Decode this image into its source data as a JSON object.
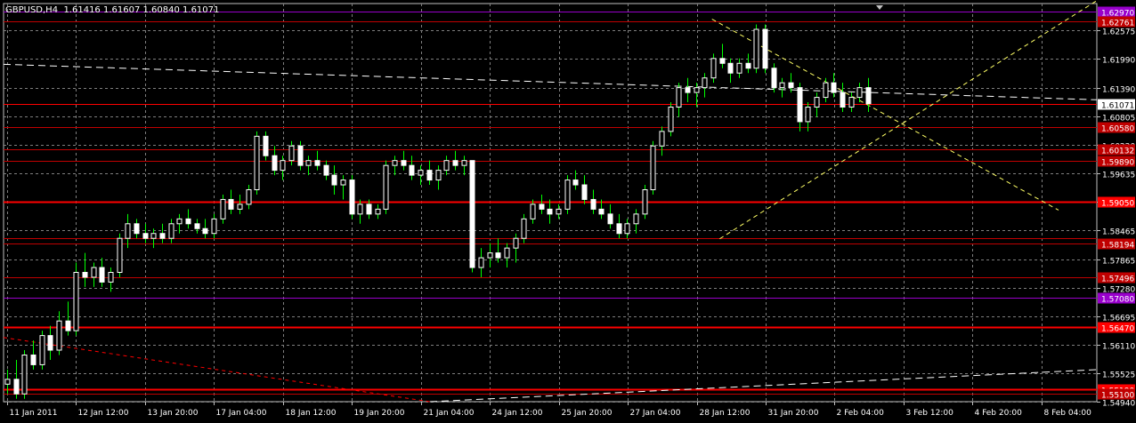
{
  "window": {
    "symbol_tf": "GBPUSD,H4",
    "ohlc": "1.61416 1.61607 1.60840 1.61071"
  },
  "colors": {
    "background": "#000000",
    "grid": "#7f7f7f",
    "candle": "#ffffff",
    "wick": "#00ff00",
    "level_red": "#ff0000",
    "level_dark_red": "#c00000",
    "level_purple": "#9900cc",
    "trend_yellow": "#ffff66",
    "trend_white": "#ffffff",
    "trend_red": "#ff0000",
    "axis_text": "#ffffff"
  },
  "chart_data": {
    "type": "candlestick",
    "title": "GBPUSD,H4",
    "ylim": [
      1.5494,
      1.6313
    ],
    "y_ticks": [
      "1.62575",
      "1.61990",
      "1.61390",
      "1.60805",
      "1.60220",
      "1.59635",
      "1.59050",
      "1.58465",
      "1.57865",
      "1.57280",
      "1.56695",
      "1.56110",
      "1.55525",
      "1.54940"
    ],
    "x_ticks": [
      "11 Jan 2011",
      "12 Jan 12:00",
      "13 Jan 20:00",
      "17 Jan 04:00",
      "18 Jan 12:00",
      "19 Jan 20:00",
      "21 Jan 04:00",
      "24 Jan 12:00",
      "25 Jan 20:00",
      "27 Jan 04:00",
      "28 Jan 12:00",
      "31 Jan 20:00",
      "2 Feb 04:00",
      "3 Feb 12:00",
      "4 Feb 20:00",
      "8 Feb 04:00"
    ],
    "current_price": "1.61071",
    "levels": [
      {
        "price": 1.6297,
        "label": "1.62970",
        "style": "purple"
      },
      {
        "price": 1.62761,
        "label": "1.62761",
        "style": "dark_red"
      },
      {
        "price": 1.61071,
        "label": "1.61071",
        "style": "current"
      },
      {
        "price": 1.6058,
        "label": "1.60580",
        "style": "dark_red"
      },
      {
        "price": 1.60132,
        "label": "1.60132",
        "style": "dark_red"
      },
      {
        "price": 1.5989,
        "label": "1.59890",
        "style": "dark_red"
      },
      {
        "price": 1.5905,
        "label": "1.59050",
        "style": "red"
      },
      {
        "price": 1.583,
        "label": "",
        "style": "dark_red"
      },
      {
        "price": 1.58194,
        "label": "1.58194",
        "style": "dark_red"
      },
      {
        "price": 1.57496,
        "label": "1.57496",
        "style": "dark_red"
      },
      {
        "price": 1.5708,
        "label": "1.57080",
        "style": "purple"
      },
      {
        "price": 1.5647,
        "label": "1.56470",
        "style": "red"
      },
      {
        "price": 1.5519,
        "label": "1.55190",
        "style": "red"
      },
      {
        "price": 1.551,
        "label": "1.55100",
        "style": "dark_red"
      }
    ],
    "candles": [
      [
        1.553,
        1.556,
        1.551,
        1.554
      ],
      [
        1.554,
        1.558,
        1.55,
        1.551
      ],
      [
        1.551,
        1.56,
        1.55,
        1.559
      ],
      [
        1.559,
        1.562,
        1.556,
        1.557
      ],
      [
        1.557,
        1.564,
        1.556,
        1.563
      ],
      [
        1.563,
        1.565,
        1.558,
        1.56
      ],
      [
        1.56,
        1.568,
        1.559,
        1.566
      ],
      [
        1.566,
        1.57,
        1.563,
        1.564
      ],
      [
        1.564,
        1.578,
        1.563,
        1.576
      ],
      [
        1.576,
        1.58,
        1.573,
        1.575
      ],
      [
        1.575,
        1.578,
        1.573,
        1.577
      ],
      [
        1.577,
        1.579,
        1.573,
        1.574
      ],
      [
        1.574,
        1.577,
        1.572,
        1.576
      ],
      [
        1.576,
        1.584,
        1.575,
        1.583
      ],
      [
        1.583,
        1.588,
        1.581,
        1.586
      ],
      [
        1.586,
        1.587,
        1.583,
        1.584
      ],
      [
        1.584,
        1.586,
        1.582,
        1.583
      ],
      [
        1.583,
        1.585,
        1.581,
        1.584
      ],
      [
        1.584,
        1.586,
        1.582,
        1.583
      ],
      [
        1.583,
        1.587,
        1.582,
        1.586
      ],
      [
        1.586,
        1.588,
        1.584,
        1.587
      ],
      [
        1.587,
        1.589,
        1.585,
        1.586
      ],
      [
        1.586,
        1.587,
        1.584,
        1.585
      ],
      [
        1.585,
        1.587,
        1.583,
        1.584
      ],
      [
        1.584,
        1.588,
        1.583,
        1.587
      ],
      [
        1.587,
        1.592,
        1.586,
        1.591
      ],
      [
        1.591,
        1.593,
        1.588,
        1.589
      ],
      [
        1.589,
        1.592,
        1.588,
        1.59
      ],
      [
        1.59,
        1.594,
        1.589,
        1.593
      ],
      [
        1.593,
        1.605,
        1.592,
        1.604
      ],
      [
        1.604,
        1.605,
        1.599,
        1.6
      ],
      [
        1.6,
        1.602,
        1.596,
        1.597
      ],
      [
        1.597,
        1.6,
        1.595,
        1.599
      ],
      [
        1.599,
        1.603,
        1.598,
        1.602
      ],
      [
        1.602,
        1.603,
        1.597,
        1.598
      ],
      [
        1.598,
        1.6,
        1.596,
        1.599
      ],
      [
        1.599,
        1.601,
        1.597,
        1.598
      ],
      [
        1.598,
        1.599,
        1.595,
        1.596
      ],
      [
        1.596,
        1.598,
        1.592,
        1.594
      ],
      [
        1.594,
        1.596,
        1.591,
        1.595
      ],
      [
        1.595,
        1.596,
        1.587,
        1.588
      ],
      [
        1.588,
        1.591,
        1.586,
        1.59
      ],
      [
        1.59,
        1.591,
        1.587,
        1.588
      ],
      [
        1.588,
        1.59,
        1.587,
        1.589
      ],
      [
        1.589,
        1.599,
        1.588,
        1.598
      ],
      [
        1.598,
        1.6,
        1.596,
        1.599
      ],
      [
        1.599,
        1.601,
        1.597,
        1.598
      ],
      [
        1.598,
        1.6,
        1.595,
        1.596
      ],
      [
        1.596,
        1.598,
        1.594,
        1.597
      ],
      [
        1.597,
        1.599,
        1.594,
        1.595
      ],
      [
        1.595,
        1.598,
        1.593,
        1.597
      ],
      [
        1.597,
        1.6,
        1.596,
        1.599
      ],
      [
        1.599,
        1.601,
        1.597,
        1.598
      ],
      [
        1.598,
        1.6,
        1.596,
        1.599
      ],
      [
        1.599,
        1.599,
        1.576,
        1.577
      ],
      [
        1.577,
        1.581,
        1.575,
        1.579
      ],
      [
        1.579,
        1.582,
        1.577,
        1.58
      ],
      [
        1.58,
        1.583,
        1.578,
        1.579
      ],
      [
        1.579,
        1.582,
        1.577,
        1.581
      ],
      [
        1.581,
        1.584,
        1.578,
        1.583
      ],
      [
        1.583,
        1.588,
        1.582,
        1.587
      ],
      [
        1.587,
        1.591,
        1.586,
        1.59
      ],
      [
        1.59,
        1.592,
        1.588,
        1.589
      ],
      [
        1.589,
        1.591,
        1.586,
        1.588
      ],
      [
        1.588,
        1.59,
        1.587,
        1.589
      ],
      [
        1.589,
        1.596,
        1.588,
        1.595
      ],
      [
        1.595,
        1.597,
        1.593,
        1.594
      ],
      [
        1.594,
        1.596,
        1.59,
        1.591
      ],
      [
        1.591,
        1.593,
        1.588,
        1.589
      ],
      [
        1.589,
        1.591,
        1.587,
        1.588
      ],
      [
        1.588,
        1.59,
        1.585,
        1.586
      ],
      [
        1.586,
        1.588,
        1.583,
        1.584
      ],
      [
        1.584,
        1.587,
        1.583,
        1.586
      ],
      [
        1.586,
        1.589,
        1.584,
        1.588
      ],
      [
        1.588,
        1.594,
        1.587,
        1.593
      ],
      [
        1.593,
        1.603,
        1.592,
        1.602
      ],
      [
        1.602,
        1.606,
        1.6,
        1.605
      ],
      [
        1.605,
        1.611,
        1.604,
        1.61
      ],
      [
        1.61,
        1.615,
        1.608,
        1.614
      ],
      [
        1.614,
        1.616,
        1.611,
        1.613
      ],
      [
        1.613,
        1.615,
        1.61,
        1.614
      ],
      [
        1.614,
        1.617,
        1.612,
        1.616
      ],
      [
        1.616,
        1.621,
        1.615,
        1.62
      ],
      [
        1.62,
        1.623,
        1.618,
        1.619
      ],
      [
        1.619,
        1.62,
        1.615,
        1.617
      ],
      [
        1.617,
        1.62,
        1.616,
        1.619
      ],
      [
        1.619,
        1.621,
        1.617,
        1.618
      ],
      [
        1.618,
        1.627,
        1.617,
        1.626
      ],
      [
        1.626,
        1.627,
        1.617,
        1.618
      ],
      [
        1.618,
        1.619,
        1.613,
        1.614
      ],
      [
        1.614,
        1.616,
        1.612,
        1.615
      ],
      [
        1.615,
        1.617,
        1.613,
        1.614
      ],
      [
        1.614,
        1.615,
        1.605,
        1.607
      ],
      [
        1.607,
        1.611,
        1.605,
        1.61
      ],
      [
        1.61,
        1.613,
        1.608,
        1.612
      ],
      [
        1.612,
        1.616,
        1.611,
        1.615
      ],
      [
        1.615,
        1.617,
        1.612,
        1.613
      ],
      [
        1.613,
        1.615,
        1.609,
        1.61
      ],
      [
        1.61,
        1.613,
        1.609,
        1.612
      ],
      [
        1.612,
        1.615,
        1.611,
        1.614
      ],
      [
        1.614,
        1.616,
        1.609,
        1.6107
      ]
    ],
    "trendlines": [
      {
        "style": "yellow_dash",
        "from": [
          0.655,
          1.5829
        ],
        "to": [
          1.0,
          1.6319
        ]
      },
      {
        "style": "yellow_dash",
        "from": [
          0.648,
          1.6281
        ],
        "to": [
          0.965,
          1.5888
        ]
      },
      {
        "style": "white_dash",
        "from": [
          0.0,
          1.6188
        ],
        "to": [
          1.0,
          1.6115
        ]
      },
      {
        "style": "white_dash",
        "from": [
          0.39,
          1.5494
        ],
        "to": [
          1.0,
          1.556
        ]
      },
      {
        "style": "red_dash",
        "from": [
          0.0,
          1.5626
        ],
        "to": [
          0.39,
          1.5494
        ]
      }
    ]
  }
}
